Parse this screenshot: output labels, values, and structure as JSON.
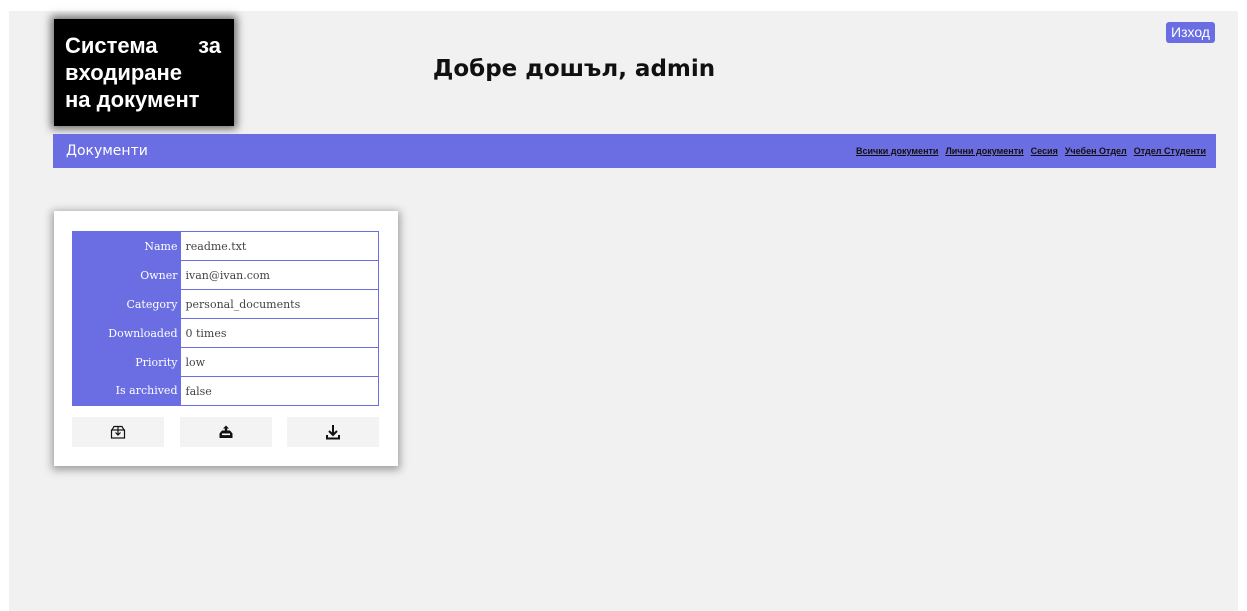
{
  "header": {
    "logo_lines": [
      [
        "Система",
        "за"
      ],
      [
        "входиране"
      ],
      [
        "на документ"
      ]
    ],
    "welcome": "Добре дошъл, admin",
    "logout_label": "Изход"
  },
  "navbar": {
    "title": "Документи",
    "links": [
      "Всички документи",
      "Лични документи",
      "Сесия",
      "Учебен Отдел",
      "Отдел Студенти"
    ]
  },
  "document": {
    "fields": [
      {
        "key": "Name",
        "value": "readme.txt"
      },
      {
        "key": "Owner",
        "value": "ivan@ivan.com"
      },
      {
        "key": "Category",
        "value": "personal_documents"
      },
      {
        "key": "Downloaded",
        "value": "0 times"
      },
      {
        "key": "Priority",
        "value": "low"
      },
      {
        "key": "Is archived",
        "value": "false"
      }
    ],
    "actions": [
      {
        "name": "archive-button",
        "icon": "archive-box-icon"
      },
      {
        "name": "upload-button",
        "icon": "upload-tray-icon"
      },
      {
        "name": "download-button",
        "icon": "download-icon"
      }
    ]
  },
  "colors": {
    "accent": "#6b6ee2",
    "background": "#f1f1f1",
    "logo_bg": "#000000"
  }
}
